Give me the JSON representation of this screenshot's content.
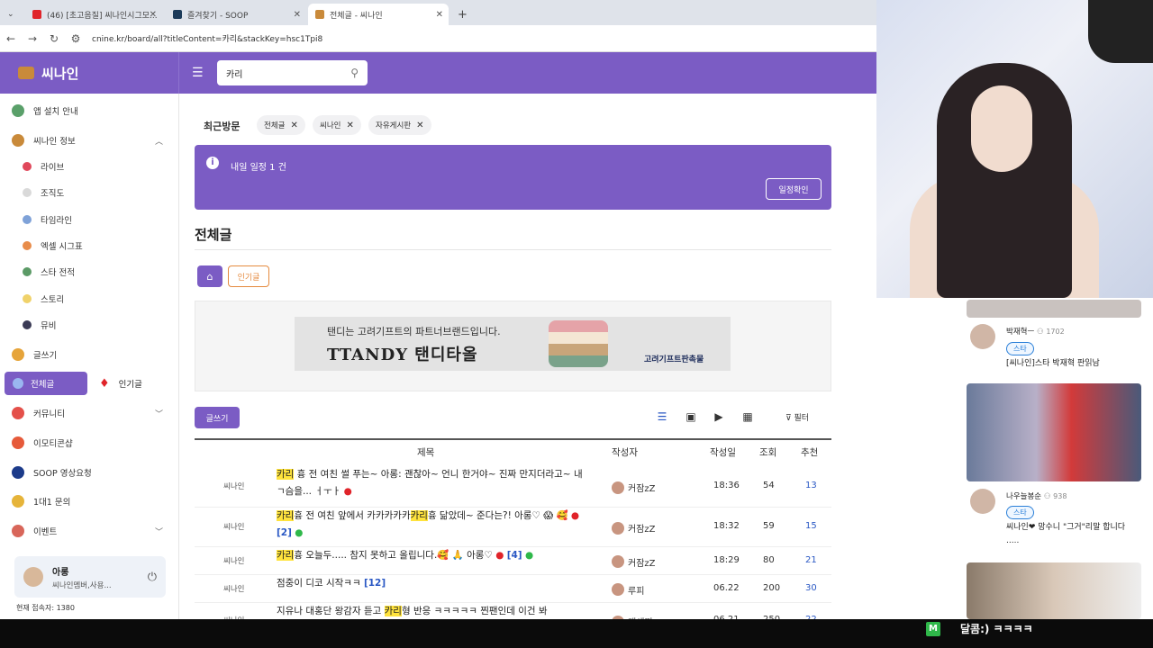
{
  "browser": {
    "tabs": [
      {
        "title": "(46) [초고음질] 씨나인시그모...",
        "fav": "#e0242a"
      },
      {
        "title": "즐겨찾기 - SOOP",
        "fav": "#1c3b5a"
      },
      {
        "title": "전체글 - 씨나인",
        "fav": "#c98a3a"
      }
    ],
    "new_tab": "+",
    "url": "cnine.kr/board/all?titleContent=카리&stackKey=hsc1Tpi8"
  },
  "site": {
    "name": "씨나인",
    "search_value": "카리"
  },
  "sidebar": {
    "items": [
      {
        "label": "앱 설치 안내",
        "color": "#5aa06a"
      },
      {
        "label": "씨나인 정보",
        "color": "#c98a3a",
        "chevron": "^"
      },
      {
        "label": "라이브",
        "color": "#e0485b"
      },
      {
        "label": "조직도",
        "color": "#d9d9d9"
      },
      {
        "label": "타임라인",
        "color": "#7fa2d8"
      },
      {
        "label": "엑셀 시그표",
        "color": "#e88c4a"
      },
      {
        "label": "스타 전적",
        "color": "#5b9a66"
      },
      {
        "label": "스토리",
        "color": "#f0d26a"
      },
      {
        "label": "뮤비",
        "color": "#3a3a55"
      },
      {
        "label": "글쓰기",
        "color": "#e6a43a"
      },
      {
        "label": "커뮤니티",
        "color": "#e4504a",
        "chevron": "v"
      },
      {
        "label": "이모티콘샵",
        "color": "#e65a3a"
      },
      {
        "label": "SOOP 영상요청",
        "color": "#1c3b8a"
      },
      {
        "label": "1대1 문의",
        "color": "#e6b43a"
      },
      {
        "label": "이벤트",
        "color": "#d8665a",
        "chevron": "v"
      }
    ],
    "active_board": "전체글",
    "popular_board": "인기글",
    "user": {
      "name": "아롱",
      "desc": "씨나인멤버,사용..."
    },
    "visitors": "현재 접속자: 1380"
  },
  "main": {
    "recent_label": "최근방문",
    "recent_chips": [
      "전체글",
      "씨나인",
      "자유게시판"
    ],
    "notice_text": "내일 일정 1 건",
    "schedule_button": "일정확인",
    "board_title": "전체글",
    "popular_button": "인기글",
    "ad": {
      "line1": "탠디는 고려기프트의 파트너브랜드입니다.",
      "line2": "TTANDY 탠디타올",
      "line3": "고려기프트판촉물"
    },
    "write_button": "글쓰기",
    "filter_label": "필터",
    "headers": {
      "title": "제목",
      "author": "작성자",
      "date": "작성일",
      "views": "조회",
      "rec": "추천"
    }
  },
  "posts": [
    {
      "cat": "씨나인",
      "title_html": "<span class=\"hl\">카리</span> 흉 전 여친 썰 푸는~ 아롱: 괜찮아~ 언니 한거야~ 진짜 만지더라고~ 내 ㄱ슴을... ㅓㅜㅏ <span style='color:#e0242a'>●</span>",
      "author": "커잠zZ",
      "date": "18:36",
      "views": "54",
      "rec": "13"
    },
    {
      "cat": "씨나인",
      "title_html": "<span class=\"hl\">카리</span>흉 전 여친 앞에서 카카카카카<span class=\"hl\">카리</span>흉 닮았데~ 준다는?! 아롱♡ 😱 🥰 <span style='color:#e0242a'>●</span> <span class=\"cmt\">[2]</span> <span style='color:#2fb84a'>●</span>",
      "author": "커잠zZ",
      "date": "18:32",
      "views": "59",
      "rec": "15"
    },
    {
      "cat": "씨나인",
      "title_html": "<span class=\"hl\">카리</span>흉 오늘두..... 참지 못하고 올립니다.🥰 🙏 아롱♡ <span style='color:#e0242a'>●</span> <span class=\"cmt\">[4]</span> <span style='color:#2fb84a'>●</span>",
      "author": "커잠zZ",
      "date": "18:29",
      "views": "80",
      "rec": "21"
    },
    {
      "cat": "씨나인",
      "title_html": "점중이 디코 시작ㅋㅋ <span class=\"cmt\">[12]</span>",
      "author": "루피",
      "date": "06.22",
      "views": "200",
      "rec": "30"
    },
    {
      "cat": "씨나인",
      "title_html": "지유나 대홍단 왕감자 듣고 <span class=\"hl\">카리</span>형 반응 ㅋㅋㅋㅋㅋ 찐팬인데 이건 봐",
      "author": "개새끼",
      "date": "06.21",
      "views": "250",
      "rec": "22"
    }
  ],
  "feed": [
    {
      "name": "박재혁ㅡ",
      "count": "1702",
      "badge": "스타",
      "text": "[씨나인]스타 박재혁 판읽남"
    },
    {
      "name": "나우늘봉순",
      "count": "938",
      "badge": "스타",
      "text": "씨나인❤ 망수니 \"그거\"리말 합니다 ....."
    }
  ],
  "chat": {
    "badge": "M",
    "text": "달콤:) ㅋㅋㅋㅋ"
  }
}
